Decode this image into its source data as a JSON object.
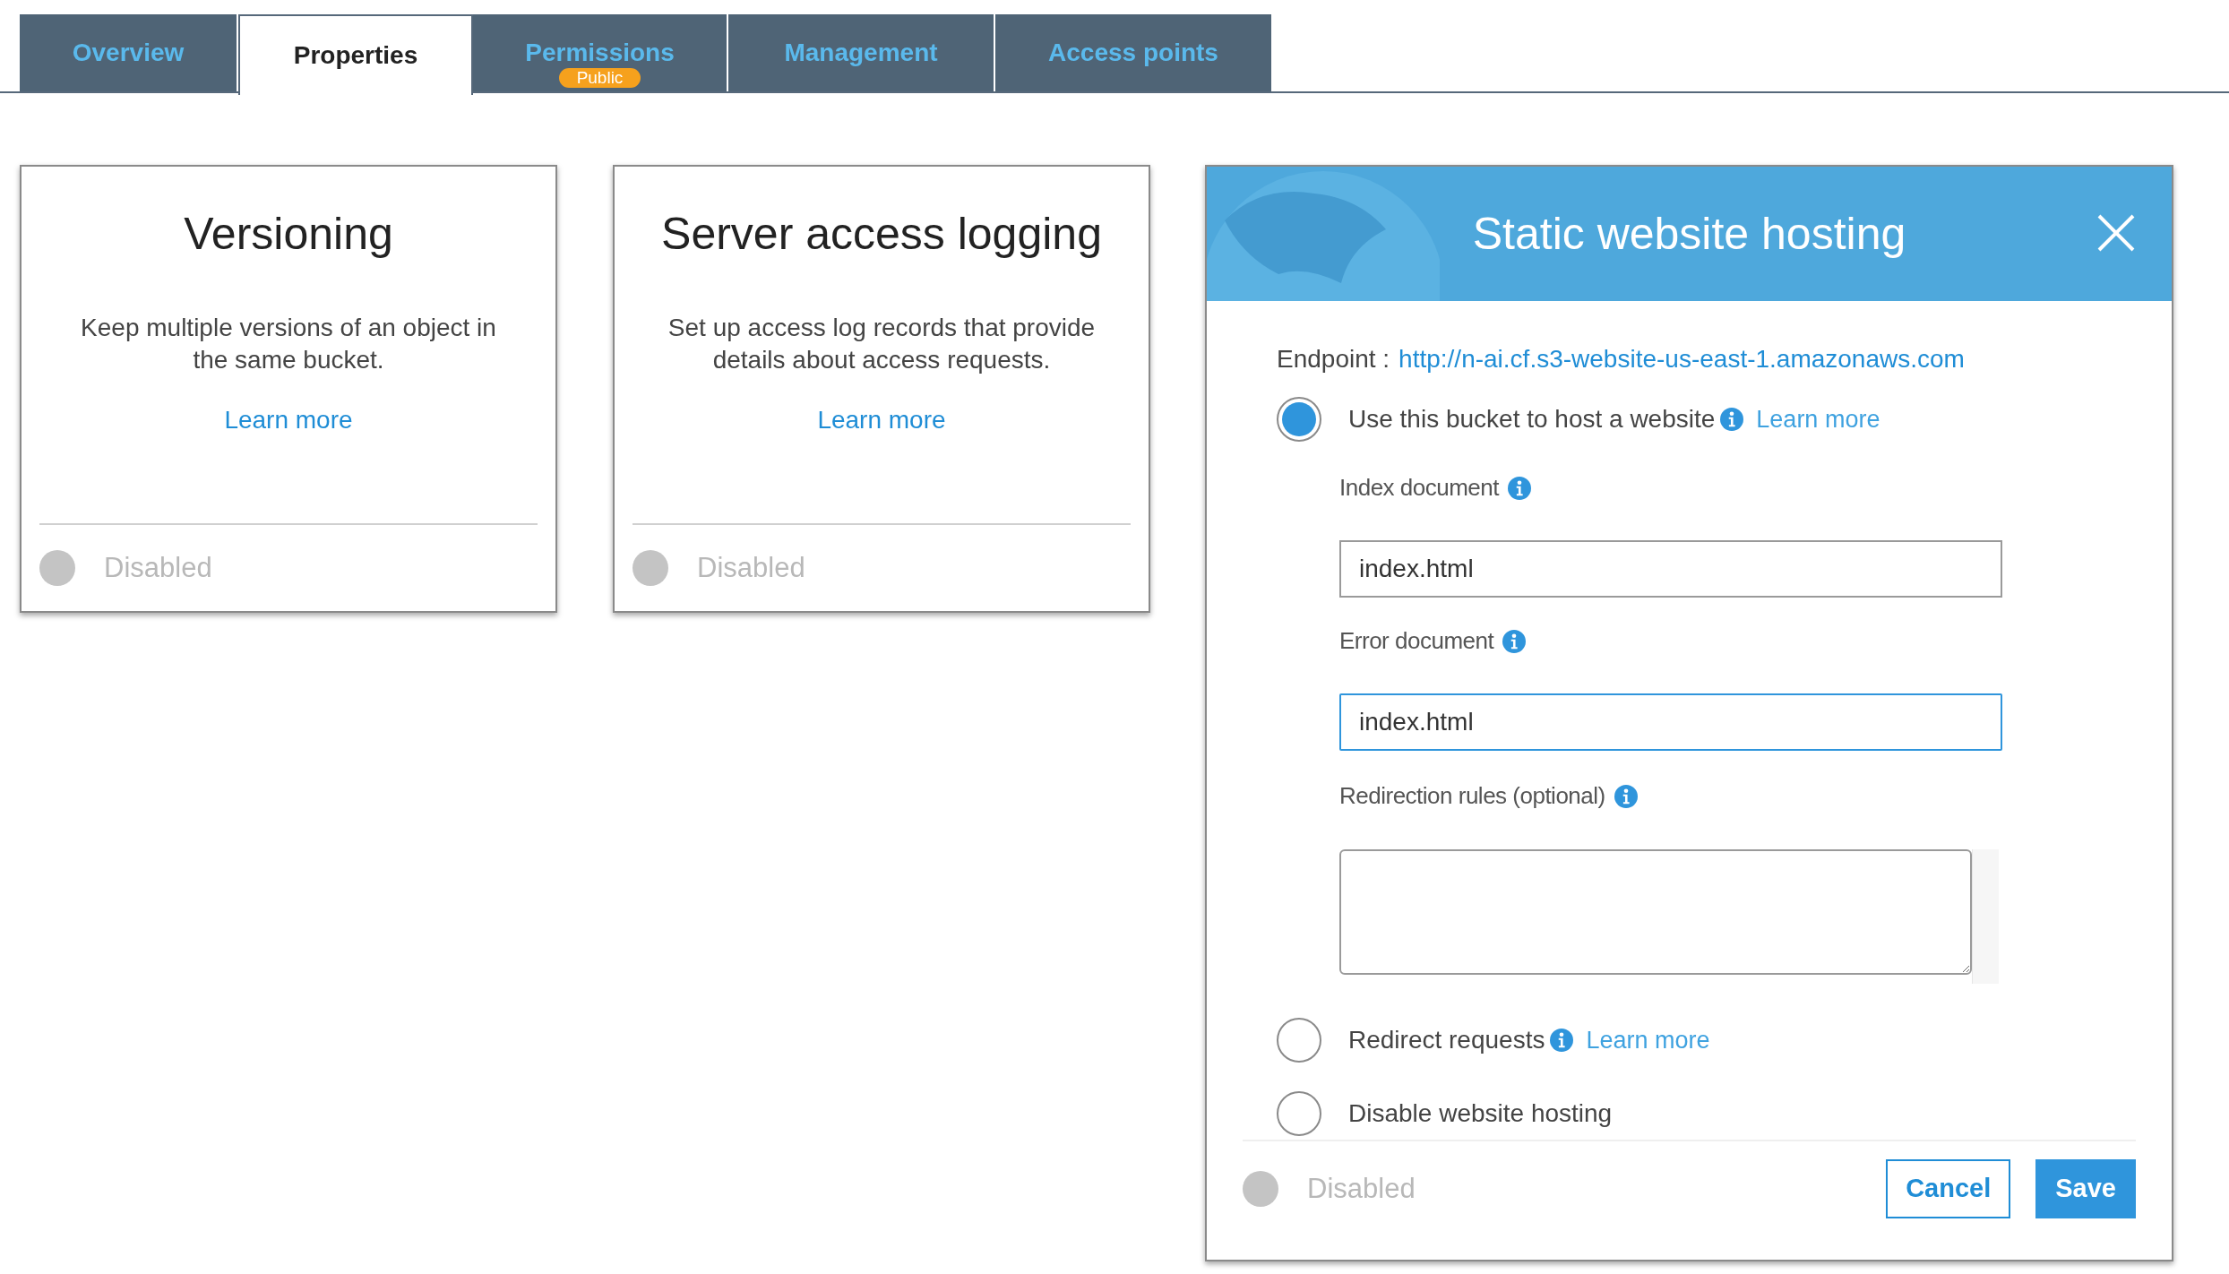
{
  "tabs": [
    {
      "label": "Overview",
      "selected": false
    },
    {
      "label": "Properties",
      "selected": true
    },
    {
      "label": "Permissions",
      "selected": false,
      "badge": "Public"
    },
    {
      "label": "Management",
      "selected": false
    },
    {
      "label": "Access points",
      "selected": false
    }
  ],
  "cards": [
    {
      "title": "Versioning",
      "description": "Keep multiple versions of an object in the same bucket.",
      "link": "Learn more",
      "status": "Disabled",
      "on": false
    },
    {
      "title": "Server access logging",
      "description": "Set up access log records that provide details about access requests.",
      "link": "Learn more",
      "status": "Disabled",
      "on": false
    }
  ],
  "dialog": {
    "title": "Static website hosting",
    "endpoint_label": "Endpoint :",
    "endpoint_url": "http://n-ai.cf.s3-website-us-east-1.amazonaws.com",
    "options": [
      {
        "label": "Use this bucket to host a website",
        "selected": true,
        "info": true,
        "link": "Learn more",
        "fields": [
          {
            "kind": "input",
            "label": "Index document",
            "value": "index.html",
            "focused": false
          },
          {
            "kind": "input",
            "label": "Error document",
            "value": "index.html",
            "focused": true
          },
          {
            "kind": "textarea",
            "label": "Redirection rules (optional)",
            "focused": false
          }
        ]
      },
      {
        "label": "Redirect requests",
        "selected": false,
        "info": true,
        "link": "Learn more"
      },
      {
        "label": "Disable website hosting",
        "selected": false,
        "info": false
      }
    ],
    "status": "Disabled",
    "on": false,
    "buttons": [
      {
        "kind": "secondary",
        "label": "Cancel"
      },
      {
        "kind": "primary",
        "label": "Save"
      }
    ]
  }
}
